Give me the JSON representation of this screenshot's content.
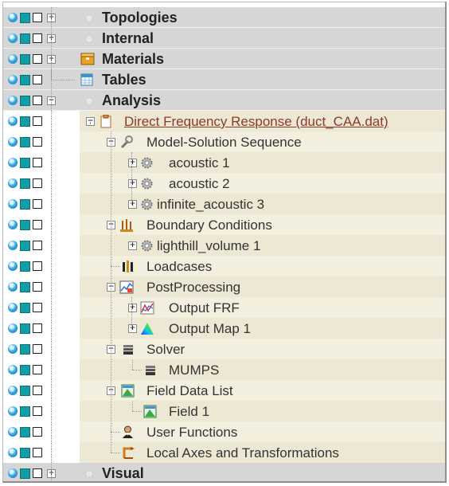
{
  "tree": {
    "topologies": "Topologies",
    "internal": "Internal",
    "materials": "Materials",
    "tables": "Tables",
    "analysis": "Analysis",
    "direct_frequency_response": "Direct Frequency Response (duct_CAA.dat)",
    "model_solution_sequence": "Model-Solution Sequence",
    "acoustic_1": "acoustic 1",
    "acoustic_2": "acoustic 2",
    "infinite_acoustic_3": "infinite_acoustic 3",
    "boundary_conditions": "Boundary Conditions",
    "lighthill_volume_1": "lighthill_volume 1",
    "loadcases": "Loadcases",
    "postprocessing": "PostProcessing",
    "output_frf": "Output FRF",
    "output_map_1": "Output Map  1",
    "solver": "Solver",
    "mumps": "MUMPS",
    "field_data_list": "Field Data List",
    "field_1": "Field 1",
    "user_functions": "User Functions",
    "local_axes": "Local Axes and Transformations",
    "visual": "Visual",
    "expand_glyph": "+",
    "collapse_glyph": "−"
  }
}
